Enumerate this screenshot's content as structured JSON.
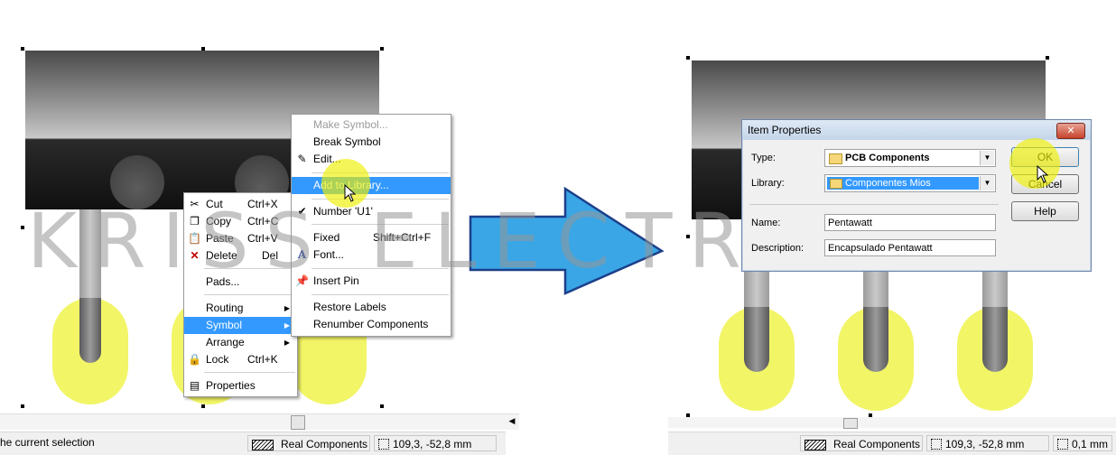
{
  "watermark": {
    "text": "KRISS  ELECTRONICS"
  },
  "context_menu_main": {
    "items": [
      {
        "label": "Cut",
        "shortcut": "Ctrl+X",
        "icon": "scissors-icon"
      },
      {
        "label": "Copy",
        "shortcut": "Ctrl+C",
        "icon": "copy-icon"
      },
      {
        "label": "Paste",
        "shortcut": "Ctrl+V",
        "icon": "paste-icon"
      },
      {
        "label": "Delete",
        "shortcut": "Del",
        "icon": "delete-x-icon"
      },
      {
        "label": "Pads..."
      },
      {
        "label": "Routing"
      },
      {
        "label": "Symbol"
      },
      {
        "label": "Arrange"
      },
      {
        "label": "Lock",
        "shortcut": "Ctrl+K",
        "icon": "lock-icon"
      },
      {
        "label": "Properties",
        "icon": "properties-icon"
      }
    ]
  },
  "context_menu_symbol": {
    "items": [
      {
        "label": "Make Symbol..."
      },
      {
        "label": "Break Symbol"
      },
      {
        "label": "Edit...",
        "icon": "edit-icon"
      },
      {
        "label": "Add to Library..."
      },
      {
        "label": "Number 'U1'"
      },
      {
        "label": "Fixed",
        "shortcut": "Shift+Ctrl+F"
      },
      {
        "label": "Font...",
        "icon": "font-icon"
      },
      {
        "label": "Insert Pin",
        "icon": "pin-icon"
      },
      {
        "label": "Restore Labels"
      },
      {
        "label": "Renumber Components"
      }
    ]
  },
  "dialog": {
    "title": "Item Properties",
    "type_label": "Type:",
    "type_value": "PCB Components",
    "library_label": "Library:",
    "library_value": "Componentes Mios",
    "name_label": "Name:",
    "name_value": "Pentawatt",
    "description_label": "Description:",
    "description_value": "Encapsulado Pentawatt",
    "ok_label": "OK",
    "cancel_label": "Cancel",
    "help_label": "Help"
  },
  "status_left": {
    "message": "he current selection",
    "layer": "Real Components",
    "coords": "109,3, -52,8 mm"
  },
  "status_right": {
    "layer": "Real Components",
    "coords": "109,3, -52,8 mm",
    "grid": "0,1 mm"
  },
  "colors": {
    "menu_highlight": "#3399ff",
    "pad_yellow": "#f2f566",
    "arrow_blue": "#3a9be0",
    "cursor_highlight": "#eef000"
  }
}
